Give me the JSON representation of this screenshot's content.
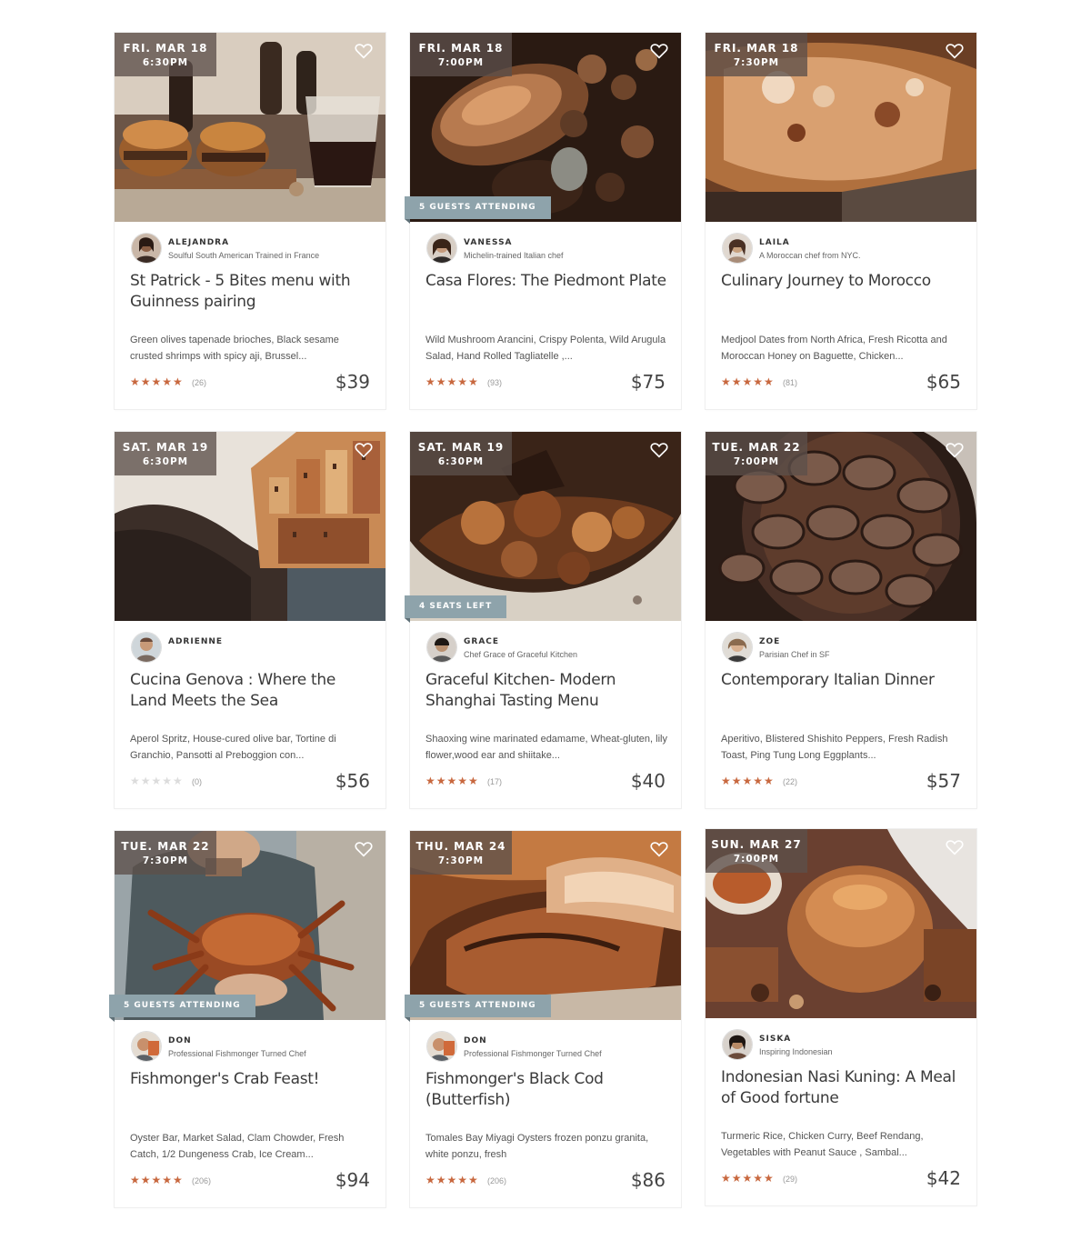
{
  "cards": [
    {
      "date": "FRI. MAR 18",
      "time": "6:30PM",
      "ribbon": "",
      "chef_name": "ALEJANDRA",
      "chef_tagline": "Soulful South American Trained in France",
      "title": "St Patrick - 5 Bites menu with Guinness pairing",
      "menu": "Green olives tapenade brioches, Black sesame crusted shrimps with spicy aji, Brussel...",
      "rating": 5,
      "stars": "★★★★★",
      "reviews": "(26)",
      "price": "$39"
    },
    {
      "date": "FRI. MAR 18",
      "time": "7:00PM",
      "ribbon": "5 GUESTS ATTENDING",
      "chef_name": "VANESSA",
      "chef_tagline": "Michelin-trained Italian chef",
      "title": "Casa Flores: The Piedmont Plate",
      "menu": "Wild Mushroom Arancini, Crispy Polenta, Wild Arugula Salad, Hand Rolled Tagliatelle ,...",
      "rating": 5,
      "stars": "★★★★★",
      "reviews": "(93)",
      "price": "$75"
    },
    {
      "date": "FRI. MAR 18",
      "time": "7:30PM",
      "ribbon": "",
      "chef_name": "LAILA",
      "chef_tagline": "A Moroccan chef from NYC.",
      "title": "Culinary Journey to Morocco",
      "menu": "Medjool Dates from North Africa, Fresh Ricotta and Moroccan Honey on Baguette, Chicken...",
      "rating": 5,
      "stars": "★★★★★",
      "reviews": "(81)",
      "price": "$65"
    },
    {
      "date": "SAT. MAR 19",
      "time": "6:30PM",
      "ribbon": "",
      "chef_name": "ADRIENNE",
      "chef_tagline": "",
      "title": "Cucina Genova : Where the Land Meets the Sea",
      "menu": "Aperol Spritz, House-cured olive bar, Tortine di Granchio, Pansotti al Preboggion con...",
      "rating": 0,
      "stars": "★★★★★",
      "reviews": "(0)",
      "price": "$56"
    },
    {
      "date": "SAT. MAR 19",
      "time": "6:30PM",
      "ribbon": "4 SEATS LEFT",
      "chef_name": "GRACE",
      "chef_tagline": "Chef Grace of Graceful Kitchen",
      "title": "Graceful Kitchen- Modern Shanghai Tasting Menu",
      "menu": "Shaoxing wine marinated edamame, Wheat-gluten, lily flower,wood ear and shiitake...",
      "rating": 5,
      "stars": "★★★★★",
      "reviews": "(17)",
      "price": "$40"
    },
    {
      "date": "TUE. MAR 22",
      "time": "7:00PM",
      "ribbon": "",
      "chef_name": "ZOE",
      "chef_tagline": "Parisian Chef in SF",
      "title": "Contemporary Italian Dinner",
      "menu": "Aperitivo, Blistered Shishito Peppers, Fresh Radish Toast, Ping Tung Long Eggplants...",
      "rating": 5,
      "stars": "★★★★★",
      "reviews": "(22)",
      "price": "$57"
    },
    {
      "date": "TUE. MAR 22",
      "time": "7:30PM",
      "ribbon": "5 GUESTS ATTENDING",
      "chef_name": "DON",
      "chef_tagline": "Professional Fishmonger Turned Chef",
      "title": "Fishmonger's Crab Feast!",
      "menu": "Oyster Bar, Market Salad, Clam Chowder, Fresh Catch, 1/2 Dungeness Crab, Ice Cream...",
      "rating": 5,
      "stars": "★★★★★",
      "reviews": "(206)",
      "price": "$94"
    },
    {
      "date": "THU. MAR 24",
      "time": "7:30PM",
      "ribbon": "5 GUESTS ATTENDING",
      "chef_name": "DON",
      "chef_tagline": "Professional Fishmonger Turned Chef",
      "title": "Fishmonger's Black Cod (Butterfish)",
      "menu": "Tomales Bay Miyagi Oysters frozen ponzu granita, white ponzu, fresh",
      "rating": 5,
      "stars": "★★★★★",
      "reviews": "(206)",
      "price": "$86"
    },
    {
      "date": "SUN. MAR 27",
      "time": "7:00PM",
      "ribbon": "",
      "chef_name": "SISKA",
      "chef_tagline": "Inspiring Indonesian",
      "title": "Indonesian Nasi Kuning: A Meal of Good fortune",
      "menu": "Turmeric Rice, Chicken Curry, Beef Rendang, Vegetables with Peanut Sauce , Sambal...",
      "rating": 5,
      "stars": "★★★★★",
      "reviews": "(29)",
      "price": "$42"
    }
  ],
  "colors": {
    "star": "#c8683f",
    "star_empty": "#dcdcdc",
    "badge": "#5c504a",
    "ribbon": "#8ea3ab"
  },
  "icons": {
    "favorite": "heart-outline-icon",
    "rating": "star-icon"
  }
}
